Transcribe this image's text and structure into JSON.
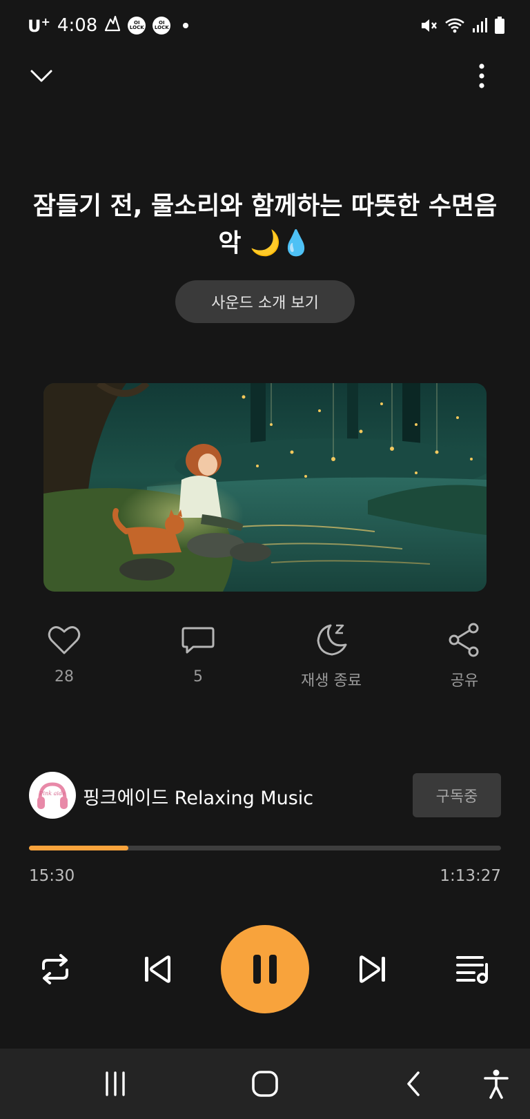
{
  "status_bar": {
    "carrier": "U",
    "carrier_sup": "+",
    "time": "4:08",
    "badges": [
      "OI LOCK",
      "OI LOCK"
    ],
    "icons": [
      "mountain-app-icon",
      "mute-icon",
      "wifi-icon",
      "signal-icon",
      "battery-icon"
    ]
  },
  "top_bar": {
    "collapse_icon": "chevron-down-icon",
    "menu_icon": "more-vertical-icon"
  },
  "track": {
    "title": "잠들기 전, 물소리와 함께하는 따뜻한 수면음악 🌙💧",
    "intro_button": "사운드 소개 보기",
    "artwork": "forest-lake-girl-cat-artwork"
  },
  "actions": [
    {
      "icon": "heart-icon",
      "label": "28"
    },
    {
      "icon": "comment-icon",
      "label": "5"
    },
    {
      "icon": "sleep-timer-icon",
      "label": "재생 종료"
    },
    {
      "icon": "share-icon",
      "label": "공유"
    }
  ],
  "channel": {
    "name": "핑크에이드 Relaxing Music",
    "avatar_text": "Pink aide",
    "subscribe_label": "구독중"
  },
  "playback": {
    "elapsed": "15:30",
    "total": "1:13:27",
    "progress_fraction": 0.211
  },
  "controls": {
    "repeat": "repeat-icon",
    "previous": "skip-previous-icon",
    "play_pause": "pause-icon",
    "next": "skip-next-icon",
    "queue": "playlist-icon"
  },
  "nav": {
    "recents": "recents-icon",
    "home": "home-icon",
    "back": "back-icon",
    "accessibility": "accessibility-icon"
  },
  "colors": {
    "accent": "#f8a33c",
    "background": "#161616",
    "button_bg": "#3a3a3a"
  }
}
